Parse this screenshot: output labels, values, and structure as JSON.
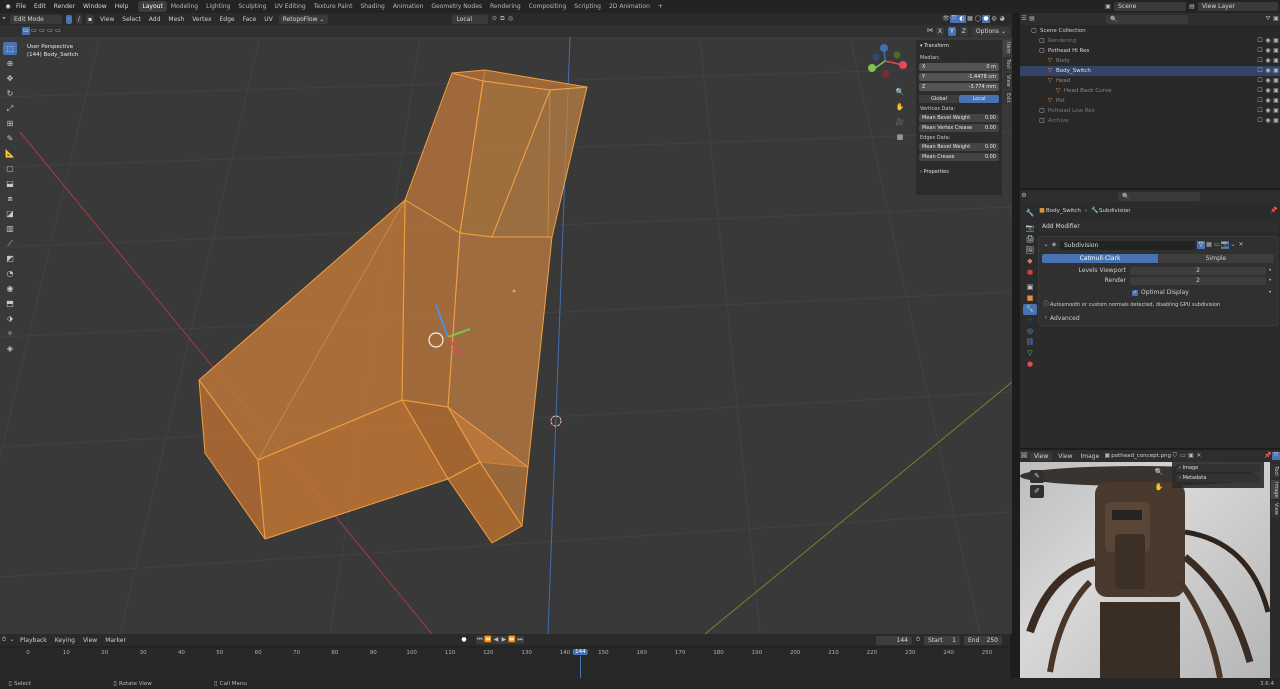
{
  "topbar": {
    "menus": [
      "File",
      "Edit",
      "Render",
      "Window",
      "Help"
    ],
    "workspaces": [
      "Layout",
      "Modeling",
      "Lighting",
      "Sculpting",
      "UV Editing",
      "Texture Paint",
      "Shading",
      "Animation",
      "Geometry Nodes",
      "Rendering",
      "Compositing",
      "Scripting",
      "2D Animation"
    ],
    "active_workspace": "Layout",
    "add_tab": "+",
    "scene": "Scene",
    "view_layer": "View Layer"
  },
  "viewport": {
    "mode": "Edit Mode",
    "menus": [
      "View",
      "Select",
      "Add",
      "Mesh",
      "Vertex",
      "Edge",
      "Face",
      "UV"
    ],
    "addon": "RetopoFlow",
    "transform_orientation": "Local",
    "overlay_title": "User Perspective",
    "overlay_object": "(144) Body_Switch",
    "options": "Options",
    "axes": {
      "x": "X",
      "y": "Y",
      "z": "Z"
    }
  },
  "npanel": {
    "title": "Transform",
    "median_label": "Median:",
    "x": {
      "label": "X",
      "value": "0 m"
    },
    "y": {
      "label": "Y",
      "value": "-1.4478 cm"
    },
    "z": {
      "label": "Z",
      "value": "-3.774 mm"
    },
    "global": "Global",
    "local": "Local",
    "vertices_label": "Vertices Data:",
    "mean_bevel_weight_v": {
      "label": "Mean Bevel Weight",
      "value": "0.00"
    },
    "mean_vertex_crease": {
      "label": "Mean Vertex Crease",
      "value": "0.00"
    },
    "edges_label": "Edges Data:",
    "mean_bevel_weight_e": {
      "label": "Mean Bevel Weight",
      "value": "0.00"
    },
    "mean_crease": {
      "label": "Mean Crease",
      "value": "0.00"
    },
    "properties": "Properties",
    "tabs": [
      "Item",
      "Tool",
      "View",
      "Edit"
    ]
  },
  "outliner": {
    "items": [
      {
        "label": "Scene Collection",
        "indent": 0,
        "color": "#cfcfcf",
        "icon": "▢"
      },
      {
        "label": "Rendering",
        "indent": 1,
        "color": "#7a7a7a",
        "icon": "▢"
      },
      {
        "label": "Pothead Hi Res",
        "indent": 1,
        "color": "#d8d8d8",
        "icon": "▢"
      },
      {
        "label": "Body",
        "indent": 2,
        "color": "#8a8a8a",
        "icon": "▽"
      },
      {
        "label": "Body_Switch",
        "indent": 2,
        "color": "#e8e8e8",
        "icon": "▽"
      },
      {
        "label": "Head",
        "indent": 2,
        "color": "#8a8a8a",
        "icon": "▽"
      },
      {
        "label": "Head Back Curve",
        "indent": 3,
        "color": "#8a8a8a",
        "icon": "▽"
      },
      {
        "label": "Pot",
        "indent": 2,
        "color": "#8a8a8a",
        "icon": "▽"
      },
      {
        "label": "Pothead Low Res",
        "indent": 1,
        "color": "#7a7a7a",
        "icon": "▢"
      },
      {
        "label": "Archive",
        "indent": 1,
        "color": "#7a7a7a",
        "icon": "▢"
      }
    ]
  },
  "properties": {
    "breadcrumb_object": "Body_Switch",
    "breadcrumb_modifier": "Subdivision",
    "add_modifier": "Add Modifier",
    "modifier_name": "Subdivision",
    "catmull": "Catmull-Clark",
    "simple": "Simple",
    "levels_viewport": {
      "label": "Levels Viewport",
      "value": "2"
    },
    "render": {
      "label": "Render",
      "value": "2"
    },
    "optimal_display": "Optimal Display",
    "warning": "Autosmooth or custom normals detected, disabling GPU subdivision",
    "advanced": "Advanced"
  },
  "image_editor": {
    "menus": [
      "View",
      "View",
      "Image"
    ],
    "image_name": "pothead_concept.png",
    "panels": [
      "Image",
      "Metadata"
    ],
    "tabs": [
      "Tool",
      "Image",
      "View"
    ]
  },
  "timeline": {
    "menus": [
      "Playback",
      "Keying",
      "View",
      "Marker"
    ],
    "current_frame": "144",
    "start_label": "Start",
    "start": "1",
    "end_label": "End",
    "end": "250",
    "ticks": [
      "0",
      "10",
      "20",
      "30",
      "40",
      "50",
      "60",
      "70",
      "80",
      "90",
      "100",
      "110",
      "120",
      "130",
      "140",
      "150",
      "160",
      "170",
      "180",
      "190",
      "200",
      "210",
      "220",
      "230",
      "240",
      "250"
    ]
  },
  "status": {
    "select": "Select",
    "rotate": "Rotate View",
    "call_menu": "Call Menu",
    "version": "3.6.4"
  },
  "colors": {
    "accent": "#4772b3",
    "mesh": "#e08a2a",
    "mesh_fill": "#c9712a"
  }
}
